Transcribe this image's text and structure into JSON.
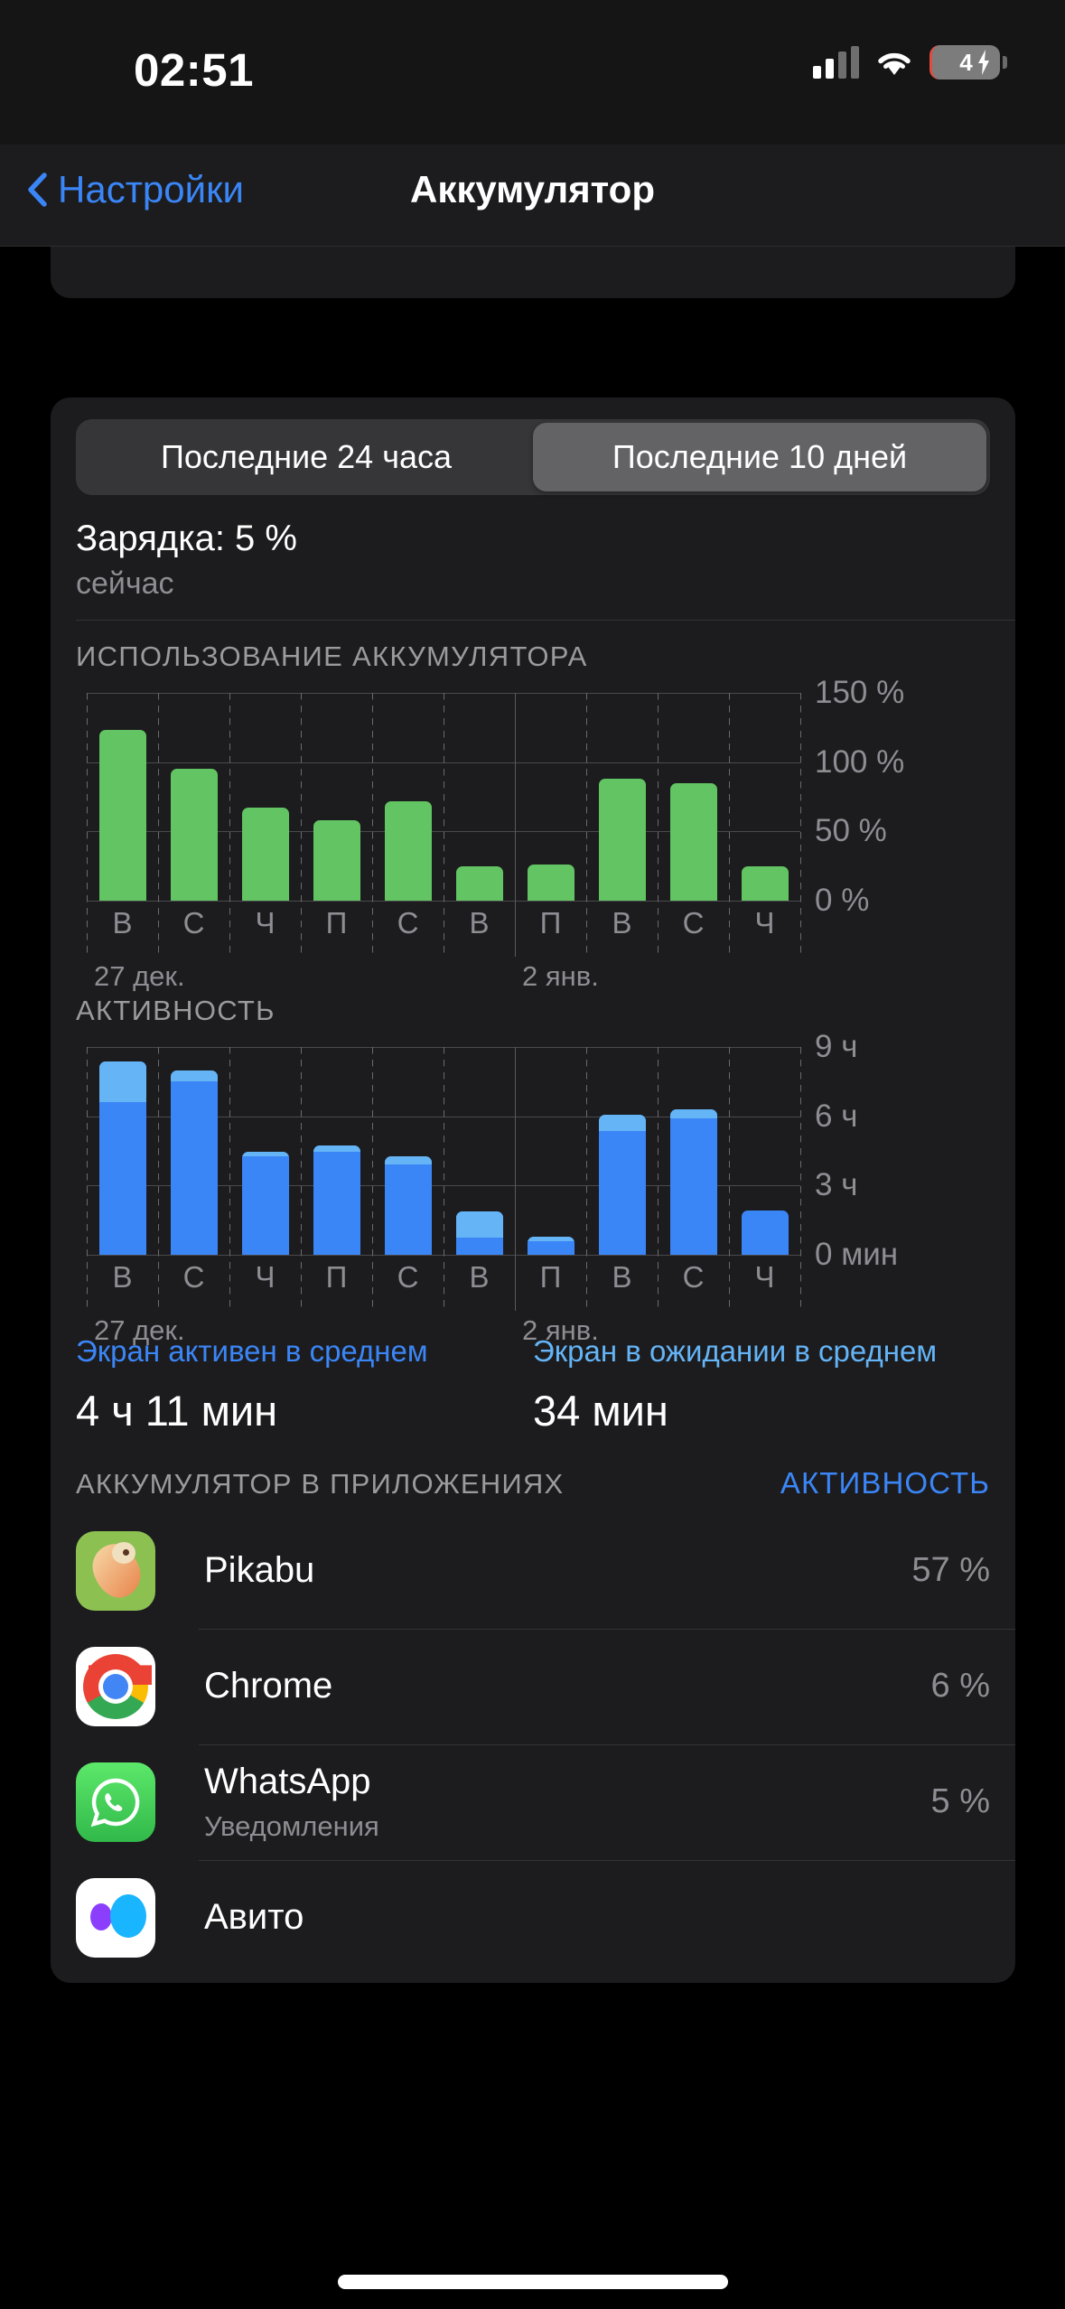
{
  "status_bar": {
    "time": "02:51",
    "battery_level": "4",
    "icons": [
      "cellular-signal-icon",
      "wifi-icon",
      "battery-charging-icon"
    ]
  },
  "nav": {
    "back_label": "Настройки",
    "title": "Аккумулятор"
  },
  "segmented": {
    "options": [
      "Последние 24 часа",
      "Последние 10 дней"
    ],
    "selected_index": 1
  },
  "charge": {
    "title": "Зарядка: 5 %",
    "subtitle": "сейчас"
  },
  "chart_data": [
    {
      "type": "bar",
      "title": "ИСПОЛЬЗОВАНИЕ АККУМУЛЯТОРА",
      "categories": [
        "В",
        "С",
        "Ч",
        "П",
        "С",
        "В",
        "П",
        "В",
        "С",
        "Ч"
      ],
      "values": [
        123,
        95,
        67,
        58,
        72,
        25,
        26,
        88,
        85,
        25
      ],
      "ytick_labels": [
        "150 %",
        "100 %",
        "50 %",
        "0 %"
      ],
      "yticks": [
        150,
        100,
        50,
        0
      ],
      "ylim": [
        0,
        150
      ],
      "xlabel": "",
      "ylabel": "",
      "date_labels": [
        {
          "text": "27 дек.",
          "at_index": 0
        },
        {
          "text": "2 янв.",
          "at_index": 6
        }
      ],
      "grid": true,
      "bar_color": "#62c462",
      "legend": []
    },
    {
      "type": "bar",
      "title": "АКТИВНОСТЬ",
      "categories": [
        "В",
        "С",
        "Ч",
        "П",
        "С",
        "В",
        "П",
        "В",
        "С",
        "Ч"
      ],
      "series": [
        {
          "name": "Экран активен в среднем",
          "color": "#3b86f7",
          "values": [
            6.6,
            7.5,
            4.25,
            4.45,
            3.9,
            0.76,
            0.6,
            5.35,
            5.9,
            1.93
          ]
        },
        {
          "name": "Экран в ожидании в среднем",
          "color": "#64b4f6",
          "values": [
            1.76,
            0.5,
            0.22,
            0.27,
            0.35,
            1.12,
            0.17,
            0.73,
            0.4,
            0.0
          ]
        }
      ],
      "ytick_labels": [
        "9 ч",
        "6 ч",
        "3 ч",
        "0 мин"
      ],
      "yticks": [
        9,
        6,
        3,
        0
      ],
      "ylim": [
        0,
        9
      ],
      "xlabel": "",
      "ylabel": "",
      "date_labels": [
        {
          "text": "27 дек.",
          "at_index": 0
        },
        {
          "text": "2 янв.",
          "at_index": 6
        }
      ],
      "grid": true,
      "stacked": true
    }
  ],
  "averages": {
    "active_label": "Экран активен в среднем",
    "active_value": "4 ч 11 мин",
    "standby_label": "Экран в ожидании в среднем",
    "standby_value": "34 мин"
  },
  "apps_section": {
    "header_left": "АККУМУЛЯТОР В ПРИЛОЖЕНИЯХ",
    "header_right": "АКТИВНОСТЬ",
    "rows": [
      {
        "name": "Pikabu",
        "subtitle": "",
        "percent": "57 %",
        "icon": "pikabu-app-icon"
      },
      {
        "name": "Chrome",
        "subtitle": "",
        "percent": "6 %",
        "icon": "chrome-app-icon"
      },
      {
        "name": "WhatsApp",
        "subtitle": "Уведомления",
        "percent": "5 %",
        "icon": "whatsapp-app-icon"
      },
      {
        "name": "Авито",
        "subtitle": "",
        "percent": "",
        "icon": "avito-app-icon"
      }
    ]
  },
  "colors": {
    "accent_blue": "#3b86f7",
    "light_blue": "#64b4f6",
    "green": "#62c462",
    "card_bg": "#1c1c1e",
    "page_bg": "#000000"
  }
}
